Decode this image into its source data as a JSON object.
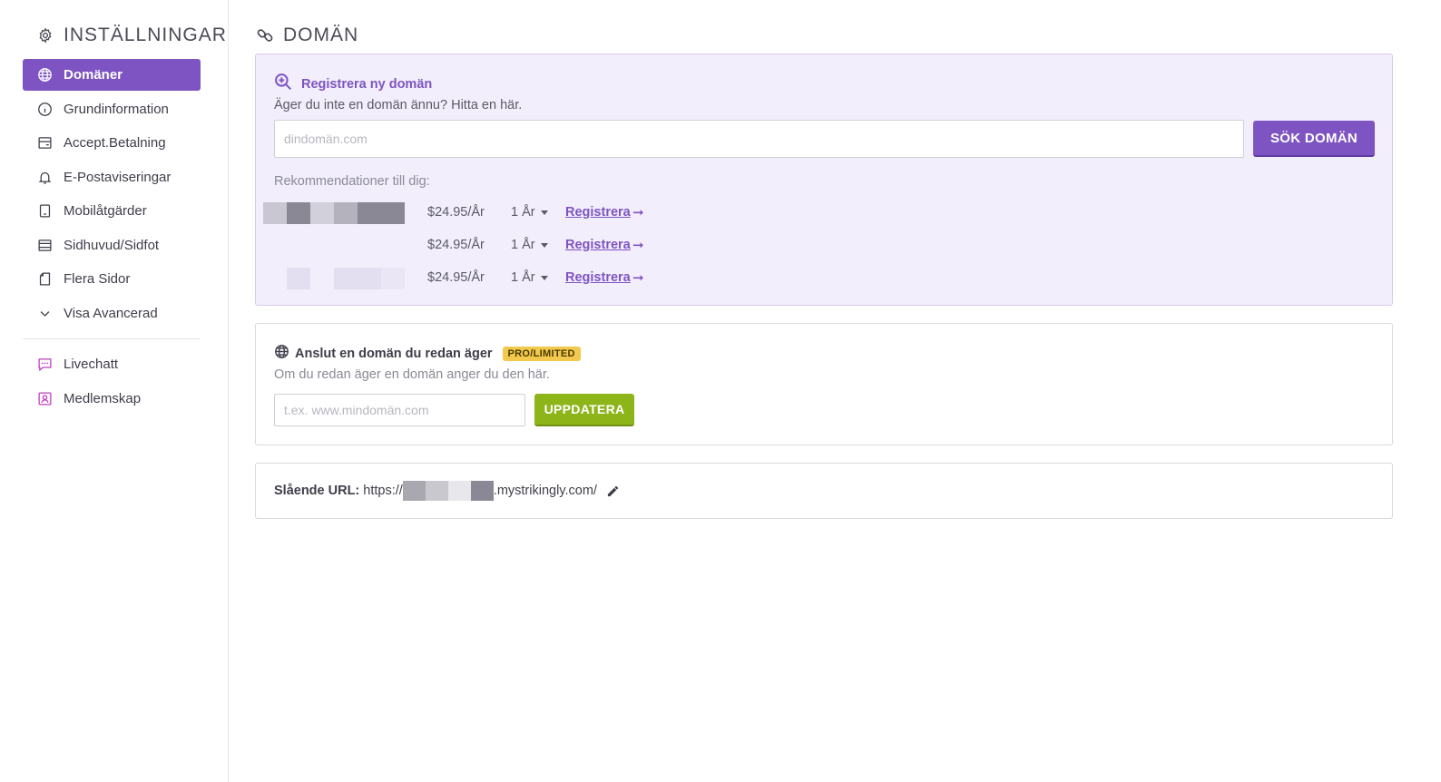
{
  "sidebar": {
    "title": "INSTÄLLNINGAR",
    "title_icon": "gear-icon",
    "items": [
      {
        "label": "Domäner",
        "icon": "globe-icon",
        "active": true
      },
      {
        "label": "Grundinformation",
        "icon": "info-icon"
      },
      {
        "label": "Accept.Betalning",
        "icon": "card-icon"
      },
      {
        "label": "E-Postaviseringar",
        "icon": "bell-icon"
      },
      {
        "label": "Mobilåtgärder",
        "icon": "mobile-icon"
      },
      {
        "label": "Sidhuvud/Sidfot",
        "icon": "layout-icon"
      },
      {
        "label": "Flera Sidor",
        "icon": "pages-icon"
      },
      {
        "label": "Visa Avancerad",
        "icon": "chevron-down-icon"
      }
    ],
    "extra_items": [
      {
        "label": "Livechatt",
        "icon": "chat-icon"
      },
      {
        "label": "Medlemskap",
        "icon": "member-icon"
      }
    ]
  },
  "main": {
    "title": "DOMÄN",
    "title_icon": "link-icon",
    "register": {
      "heading": "Registrera ny domän",
      "subtext": "Äger du inte en domän ännu? Hitta en här.",
      "search_placeholder": "dindomän.com",
      "search_button": "SÖK DOMÄN",
      "recommendations_label": "Rekommendationer till dig:",
      "recommendations": [
        {
          "price": "$24.95/År",
          "term": "1 År",
          "action": "Registrera",
          "arrow": "➞"
        },
        {
          "price": "$24.95/År",
          "term": "1 År",
          "action": "Registrera",
          "arrow": "➞"
        },
        {
          "price": "$24.95/År",
          "term": "1 År",
          "action": "Registrera",
          "arrow": "➞"
        }
      ]
    },
    "connect": {
      "heading": "Anslut en domän du redan äger",
      "badge": "PRO/LIMITED",
      "subtext": "Om du redan äger en domän anger du den här.",
      "input_placeholder": "t.ex. www.mindomän.com",
      "button": "UPPDATERA"
    },
    "url": {
      "label": "Slående URL:",
      "prefix": "https://",
      "suffix": ".mystrikingly.com/"
    }
  },
  "colors": {
    "accent": "#7d54c1",
    "accent_bg": "#f3eefc",
    "green": "#8db51a",
    "badge": "#f2c94c",
    "magenta_icon": "#c13cbf"
  }
}
